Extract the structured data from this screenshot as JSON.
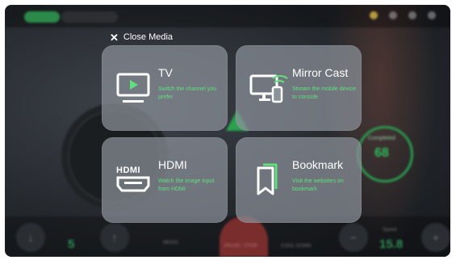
{
  "overlay": {
    "close_label": "Close Media",
    "cards": [
      {
        "title": "TV",
        "desc": "Switch the channel you prefer",
        "icon": "tv-icon"
      },
      {
        "title": "Mirror Cast",
        "desc": "Stream the mobile device to console",
        "icon": "mirror-cast-icon"
      },
      {
        "title": "HDMI",
        "desc": "Watch the image input from HDMI",
        "icon": "hdmi-icon"
      },
      {
        "title": "Bookmark",
        "desc": "Visit the websites on bookmark",
        "icon": "bookmark-icon"
      }
    ]
  },
  "background": {
    "completed_label": "Completed",
    "completed_value": "68",
    "incline_value": "5",
    "speed_label": "Speed",
    "speed_value": "15.8",
    "media_label": "MEDIA",
    "pause_label": "PAUSE / STOP",
    "cooldown_label": "COOL DOWN"
  },
  "colors": {
    "accent_green": "#5fe07e",
    "card_bg": "#8c929a",
    "pause_red": "#7a2d2d"
  }
}
